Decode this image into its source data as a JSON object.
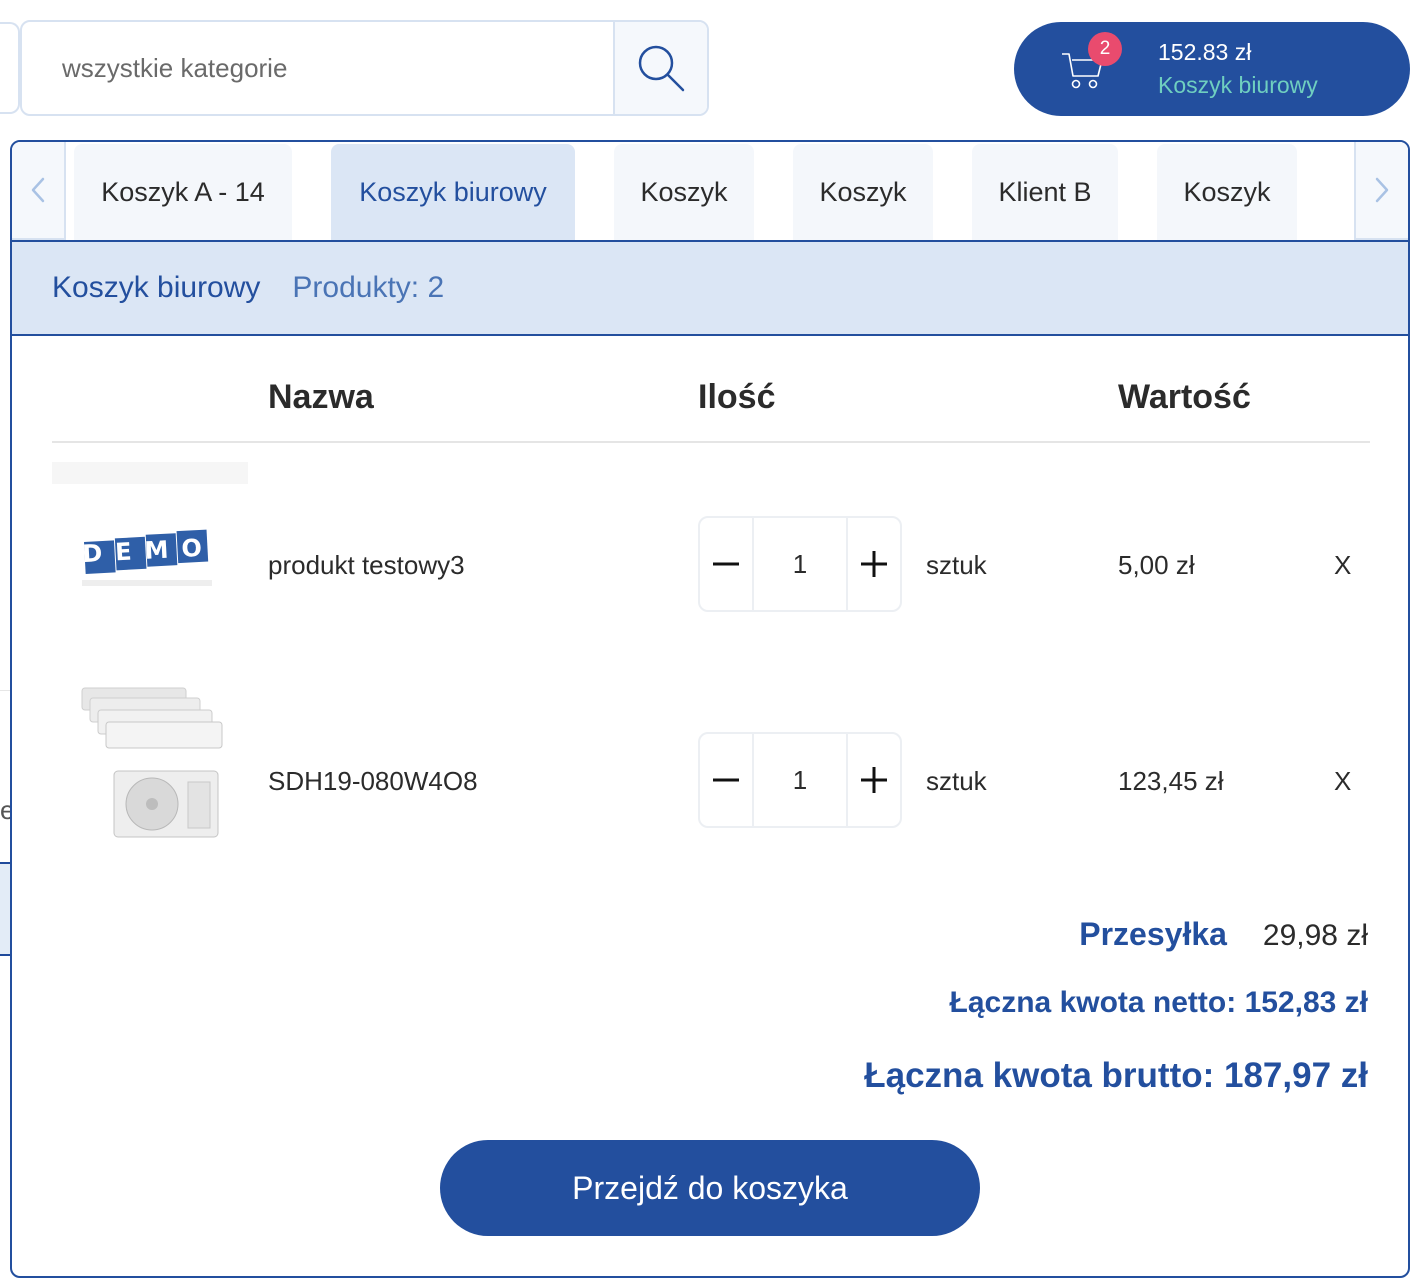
{
  "search": {
    "placeholder": "wszystkie kategorie"
  },
  "cart_button": {
    "count": "2",
    "total": "152.83 zł",
    "name": "Koszyk biurowy"
  },
  "tabs": [
    {
      "label": "Koszyk A - 14"
    },
    {
      "label": "Koszyk biurowy"
    },
    {
      "label": "Koszyk"
    },
    {
      "label": "Koszyk"
    },
    {
      "label": "Klient B"
    },
    {
      "label": "Koszyk"
    }
  ],
  "active_tab": "Koszyk biurowy",
  "cart": {
    "name": "Koszyk biurowy",
    "count_label": "Produkty: 2"
  },
  "columns": {
    "name": "Nazwa",
    "qty": "Ilość",
    "value": "Wartość"
  },
  "items": [
    {
      "name": "produkt testowy3",
      "qty": "1",
      "unit": "sztuk",
      "price": "5,00 zł",
      "remove": "X",
      "image_text": "DEMO"
    },
    {
      "name": "SDH19-080W4O8",
      "qty": "1",
      "unit": "sztuk",
      "price": "123,45 zł",
      "remove": "X"
    }
  ],
  "summary": {
    "shipping_label": "Przesyłka",
    "shipping_value": "29,98 zł",
    "net": "Łączna kwota netto: 152,83 zł",
    "gross": "Łączna kwota brutto: 187,97 zł"
  },
  "checkout_label": "Przejdź do koszyka",
  "background_fragment": "er",
  "colors": {
    "primary": "#234f9e",
    "light": "#dbe6f5",
    "badge": "#e94b6e",
    "accent": "#6fcfc0"
  }
}
